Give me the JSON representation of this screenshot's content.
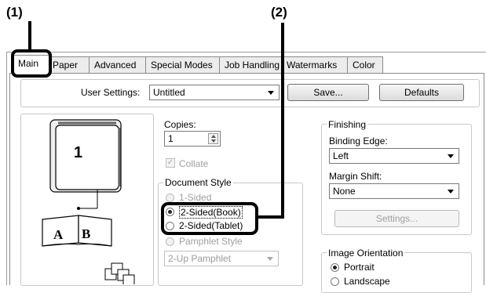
{
  "callouts": {
    "one": "(1)",
    "two": "(2)"
  },
  "tabs": [
    "Main",
    "Paper",
    "Advanced",
    "Special Modes",
    "Job Handling",
    "Watermarks",
    "Color"
  ],
  "user_settings": {
    "label": "User Settings:",
    "value": "Untitled",
    "save": "Save...",
    "defaults": "Defaults"
  },
  "preview": {
    "page_number": "1",
    "booklet_left": "A",
    "booklet_right": "B"
  },
  "copies": {
    "label": "Copies:",
    "value": "1",
    "collate": "Collate",
    "collate_checked": true
  },
  "document_style": {
    "label": "Document Style",
    "options": [
      "1-Sided",
      "2-Sided(Book)",
      "2-Sided(Tablet)",
      "Pamphlet Style"
    ],
    "selected": "2-Sided(Book)",
    "pamphlet_value": "2-Up Pamphlet"
  },
  "finishing": {
    "label": "Finishing",
    "binding_edge_label": "Binding Edge:",
    "binding_edge_value": "Left",
    "margin_shift_label": "Margin Shift:",
    "margin_shift_value": "None",
    "settings_button": "Settings..."
  },
  "image_orientation": {
    "label": "Image Orientation",
    "options": [
      "Portrait",
      "Landscape"
    ],
    "selected": "Portrait"
  },
  "colors": {
    "callout": "#000000",
    "highlight": "#000000"
  }
}
